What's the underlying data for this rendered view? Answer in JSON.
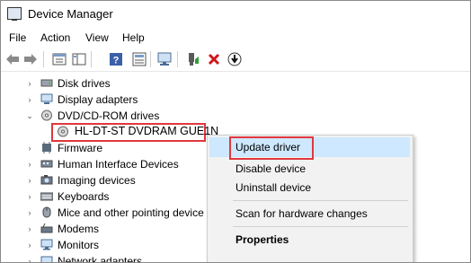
{
  "window": {
    "title": "Device Manager"
  },
  "menu": [
    "File",
    "Action",
    "View",
    "Help"
  ],
  "toolbar": {
    "buttons": [
      "back-icon",
      "forward-icon",
      "properties-icon",
      "console-tree-icon",
      "help-icon",
      "show-hidden-icon",
      "scan-changes-icon",
      "enable-device-icon",
      "uninstall-icon",
      "update-driver-icon"
    ]
  },
  "tree": {
    "items": [
      {
        "label": "Disk drives",
        "icon": "disk-icon"
      },
      {
        "label": "Display adapters",
        "icon": "display-icon"
      },
      {
        "label": "DVD/CD-ROM drives",
        "icon": "dvd-icon"
      },
      {
        "label": "HL-DT-ST DVDRAM GUE1N",
        "icon": "dvd-device-icon"
      },
      {
        "label": "Firmware",
        "icon": "firmware-icon"
      },
      {
        "label": "Human Interface Devices",
        "icon": "hid-icon"
      },
      {
        "label": "Imaging devices",
        "icon": "camera-icon"
      },
      {
        "label": "Keyboards",
        "icon": "keyboard-icon"
      },
      {
        "label": "Mice and other pointing device",
        "icon": "mouse-icon"
      },
      {
        "label": "Modems",
        "icon": "modem-icon"
      },
      {
        "label": "Monitors",
        "icon": "monitor-icon"
      },
      {
        "label": "Network adapters",
        "icon": "network-icon"
      }
    ]
  },
  "context_menu": {
    "items": [
      "Update driver",
      "Disable device",
      "Uninstall device",
      "Scan for hardware changes",
      "Properties"
    ]
  },
  "colors": {
    "highlight_border": "#e0383e",
    "menu_selection": "#cde8ff",
    "menu_bg": "#f2f2f2"
  }
}
